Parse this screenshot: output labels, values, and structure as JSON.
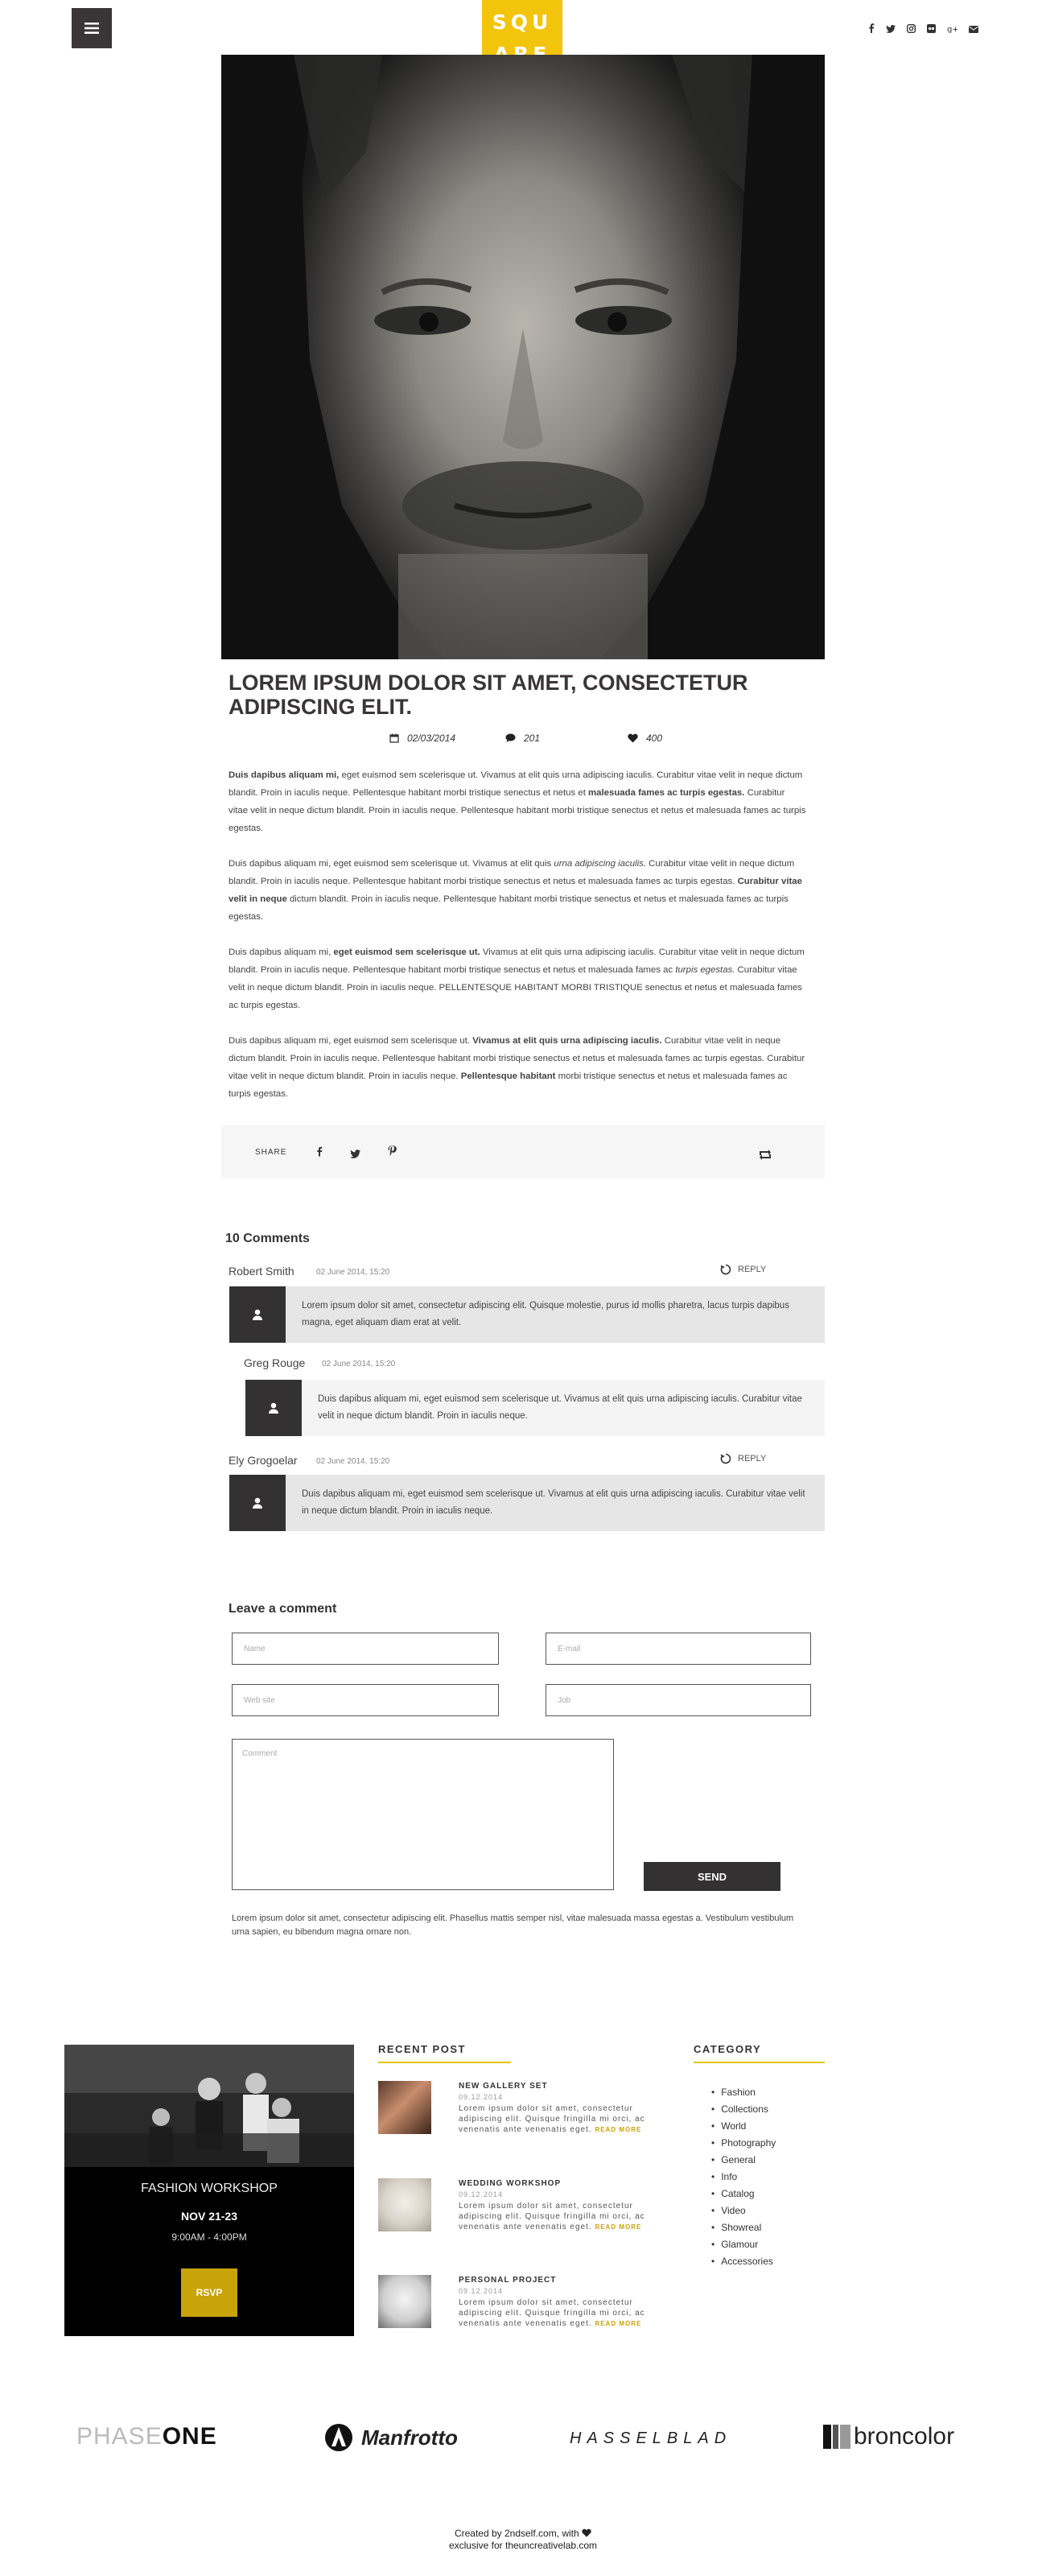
{
  "header": {
    "logo": {
      "line1": "SQU",
      "line2": "ARE"
    },
    "menu_icon": "hamburger-icon",
    "socials": [
      "facebook-icon",
      "twitter-icon",
      "instagram-icon",
      "flickr-icon",
      "google-plus-icon",
      "email-icon"
    ]
  },
  "article": {
    "title": "LOREM IPSUM DOLOR SIT AMET, CONSECTETUR ADIPISCING ELIT.",
    "date": "02/03/2014",
    "comments_count": "201",
    "likes": "400",
    "p1": {
      "bold": "Duis dapibus aliquam mi,",
      "a": " eget euismod sem scelerisque ut. Vivamus at elit quis urna adipiscing iaculis. Curabitur vitae velit in neque dictum blandit. Proin in iaculis neque. Pellentesque habitant morbi tristique senectus et netus et ",
      "bold2": "malesuada fames ac turpis egestas.",
      "b": " Curabitur vitae velit in neque dictum blandit. Proin in iaculis neque. Pellentesque habitant morbi tristique senectus et netus et malesuada fames ac turpis egestas."
    },
    "p2": {
      "a": "Duis dapibus aliquam mi, eget euismod sem scelerisque ut. Vivamus at elit quis ",
      "italic": "urna adipiscing iaculis.",
      "b": " Curabitur vitae velit in neque dictum blandit. Proin in iaculis neque. Pellentesque habitant morbi tristique senectus et netus et malesuada fames ac turpis egestas. ",
      "bold": "Curabitur vitae velit in neque",
      "c": " dictum blandit. Proin in iaculis neque. Pellentesque habitant morbi tristique senectus et netus et malesuada fames ac turpis egestas."
    },
    "p3": {
      "a": "Duis dapibus aliquam mi, ",
      "bold": "eget euismod sem scelerisque ut.",
      "b": " Vivamus at elit quis urna adipiscing iaculis. Curabitur vitae velit in neque dictum blandit. Proin in iaculis neque. Pellentesque habitant morbi tristique senectus et netus et malesuada fames ac ",
      "italic": "turpis egestas.",
      "c": " Curabitur vitae velit in neque dictum blandit. Proin in iaculis neque. PELLENTESQUE HABITANT MORBI TRISTIQUE senectus et netus et malesuada fames ac turpis egestas."
    },
    "p4": {
      "a": "Duis dapibus aliquam mi, eget euismod sem scelerisque ut. ",
      "bold": "Vivamus at elit quis urna adipiscing iaculis.",
      "b": " Curabitur vitae velit in neque dictum blandit. Proin in iaculis neque. Pellentesque habitant morbi tristique senectus et netus et malesuada fames ac turpis egestas. Curabitur vitae velit in neque dictum blandit. Proin in iaculis neque. ",
      "bold2": "Pellentesque habitant",
      "c": " morbi tristique senectus et netus et malesuada fames ac turpis egestas."
    },
    "share_label": "SHARE"
  },
  "comments": {
    "title": "10 Comments",
    "reply_label": "REPLY",
    "items": [
      {
        "author": "Robert Smith",
        "date": "02 June 2014, 15:20",
        "text": "Lorem ipsum dolor sit amet, consectetur adipiscing elit. Quisque molestie, purus id mollis pharetra, lacus turpis dapibus magna, eget aliquam diam erat at velit."
      },
      {
        "author": "Greg Rouge",
        "date": "02 June 2014, 15:20",
        "text": "Duis dapibus aliquam mi, eget euismod sem scelerisque ut. Vivamus at elit quis urna adipiscing iaculis. Curabitur vitae velit in neque dictum blandit. Proin in iaculis neque."
      },
      {
        "author": "Ely Grogoelar",
        "date": "02 June 2014, 15:20",
        "text": "Duis dapibus aliquam mi, eget euismod sem scelerisque ut. Vivamus at elit quis urna adipiscing iaculis. Curabitur vitae velit in neque dictum blandit. Proin in iaculis neque."
      }
    ]
  },
  "form": {
    "title": "Leave a comment",
    "name_placeholder": "Name",
    "email_placeholder": "E-mail",
    "website_placeholder": "Web site",
    "job_placeholder": "Job",
    "comment_placeholder": "Comment",
    "send_label": "SEND",
    "note": "Lorem ipsum dolor sit amet, consectetur adipiscing elit. Phasellus mattis semper nisl, vitae malesuada massa egestas a. Vestibulum vestibulum urna sapien, eu bibendum magna ornare non."
  },
  "workshop": {
    "title": "FASHION WORKSHOP",
    "date": "NOV 21-23",
    "time": "9:00AM - 4:00PM",
    "rsvp": "RSVP"
  },
  "recent_posts": {
    "title": "RECENT POST",
    "read_more": "READ MORE",
    "items": [
      {
        "title": "NEW GALLERY SET",
        "date": "09.12.2014",
        "excerpt": "Lorem ipsum dolor sit amet, consectetur adipiscing elit. Quisque fringilla mi orci, ac venenatis ante venenatis eget."
      },
      {
        "title": "WEDDING WORKSHOP",
        "date": "09.12.2014",
        "excerpt": "Lorem ipsum dolor sit amet, consectetur adipiscing elit. Quisque fringilla mi orci, ac venenatis ante venenatis eget."
      },
      {
        "title": "PERSONAL PROJECT",
        "date": "09.12.2014",
        "excerpt": "Lorem ipsum dolor sit amet, consectetur adipiscing elit. Quisque fringilla mi orci, ac venenatis ante venenatis eget."
      }
    ]
  },
  "categories": {
    "title": "CATEGORY",
    "items": [
      "Fashion",
      "Collections",
      "World",
      "Photography",
      "General",
      "Info",
      "Catalog",
      "Video",
      "Showreal",
      "Glamour",
      "Accessories"
    ]
  },
  "brands": {
    "phaseone_a": "PHASE",
    "phaseone_b": "ONE",
    "manfrotto": "Manfrotto",
    "hasselblad": "HASSELBLAD",
    "broncolor": "broncolor"
  },
  "footer": {
    "line1": "Created by 2ndself.com, with",
    "line2": "exclusive for theuncreativelab.com"
  },
  "colors": {
    "accent": "#f2c40c",
    "dark": "#3a3536",
    "gold": "#c9a30a"
  }
}
